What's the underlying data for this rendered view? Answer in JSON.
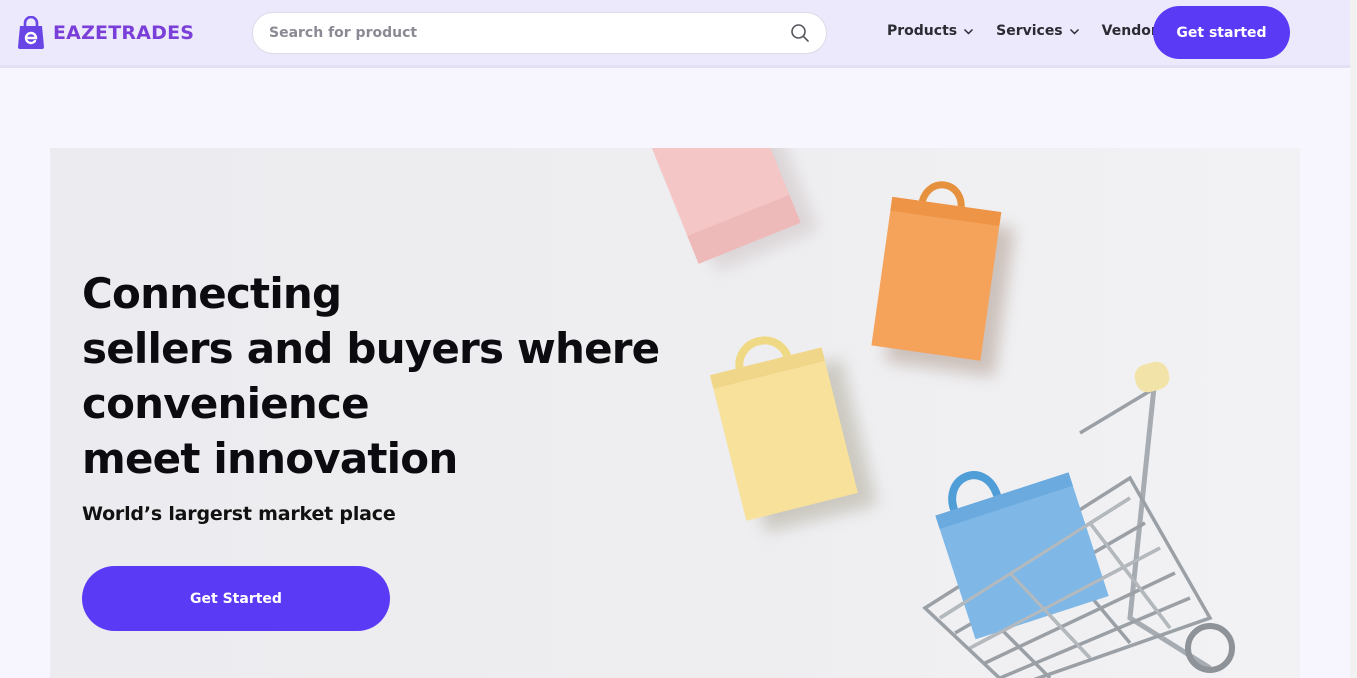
{
  "brand": {
    "name": "EAZETRADES",
    "color": "#7a3fd9"
  },
  "search": {
    "placeholder": "Search for product",
    "value": ""
  },
  "nav": {
    "items": [
      {
        "label": "Products",
        "dropdown": true
      },
      {
        "label": "Services",
        "dropdown": true
      },
      {
        "label": "Vendors",
        "dropdown": false
      }
    ],
    "cta_label": "Get started"
  },
  "hero": {
    "title_lines": [
      "Connecting",
      "sellers and buyers where",
      "convenience",
      "meet innovation"
    ],
    "subtitle": "World’s largerst market place",
    "cta_label": "Get Started"
  },
  "colors": {
    "accent": "#5b3af5",
    "header_bg": "#ebe9fb",
    "page_bg": "#f7f6ff"
  }
}
